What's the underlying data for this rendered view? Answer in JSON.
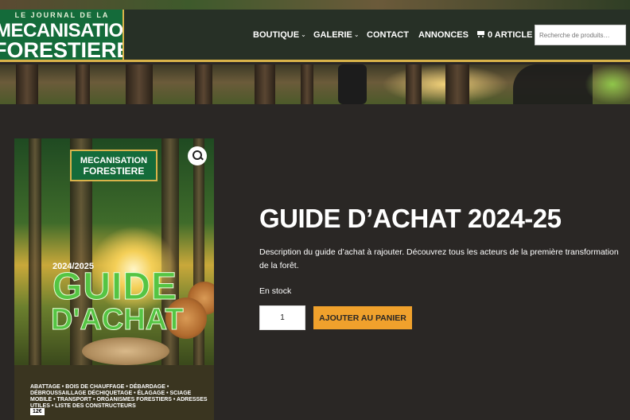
{
  "logo": {
    "line1": "LE JOURNAL DE LA",
    "line2": "MECANISATION",
    "line3": "FORESTIERE"
  },
  "nav": {
    "items": [
      {
        "label": "BOUTIQUE",
        "dropdown": true
      },
      {
        "label": "GALERIE",
        "dropdown": true
      },
      {
        "label": "CONTACT",
        "dropdown": false
      },
      {
        "label": "ANNONCES",
        "dropdown": false
      }
    ],
    "cart_label": "0 ARTICLE",
    "search_placeholder": "Recherche de produits…"
  },
  "product": {
    "title": "GUIDE D’ACHAT 2024-25",
    "description": "Description du guide d’achat à rajouter. Découvrez tous les acteurs de la première transformation de la forêt.",
    "stock": "En stock",
    "quantity": "1",
    "add_to_cart": "AJOUTER AU PANIER"
  },
  "cover": {
    "logo_line1": "MECANISATION",
    "logo_line2": "FORESTIERE",
    "year": "2024/2025",
    "title1": "GUIDE",
    "title2": "D'ACHAT",
    "topics": "ABATTAGE • BOIS DE CHAUFFAGE • DÉBARDAGE • DÉBROUSSAILLAGE DÉCHIQUETAGE • ÉLAGAGE • SCIAGE MOBILE • TRANSPORT • ORGANISMES FORESTIERS • ADRESSES UTILES • LISTE DES CONSTRUCTEURS",
    "price": "12€"
  },
  "colors": {
    "header_bg": "#273026",
    "logo_green": "#146b3a",
    "accent_gold": "#d9b34a",
    "page_bg": "#2a2725",
    "button_orange": "#f0a12c"
  }
}
